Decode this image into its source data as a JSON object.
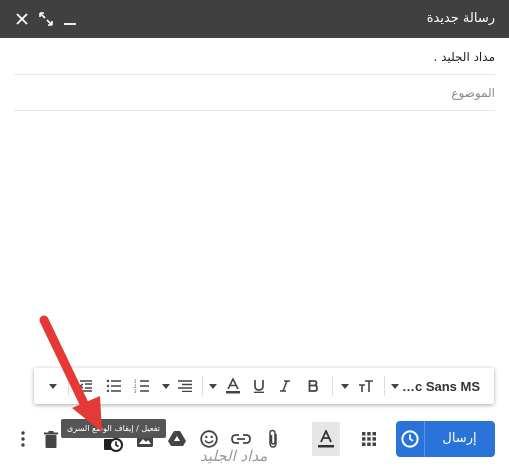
{
  "header": {
    "title": "رسالة جديدة",
    "controls": [
      "minimize-icon",
      "expand-icon",
      "close-icon"
    ]
  },
  "fields": {
    "to": "مداد الجليد .",
    "subject_placeholder": "الموضوع",
    "subject_value": ""
  },
  "format_bar": {
    "font": "Comic Sans MS",
    "font_display": "…c Sans MS",
    "buttons": [
      "font-select",
      "text-size",
      "bold",
      "italic",
      "underline",
      "text-color",
      "align",
      "numbered-list",
      "bulleted-list",
      "indent-less",
      "more"
    ]
  },
  "toolbar": {
    "send_label": "إرسال",
    "tooltip": "تفعيل / إيقاف الوضع السرى",
    "icons": [
      "schedule-send-icon",
      "more-options-icon",
      "discard-icon",
      "confidential-mode-icon",
      "insert-photo-icon",
      "drive-icon",
      "emoji-icon",
      "insert-link-icon",
      "attach-icon",
      "formatting-options-icon",
      "apps-grid-icon"
    ]
  },
  "watermark": "مداد الجليد",
  "colors": {
    "header": "#404040",
    "send": "#2a73d9",
    "arrow": "#e53935"
  }
}
